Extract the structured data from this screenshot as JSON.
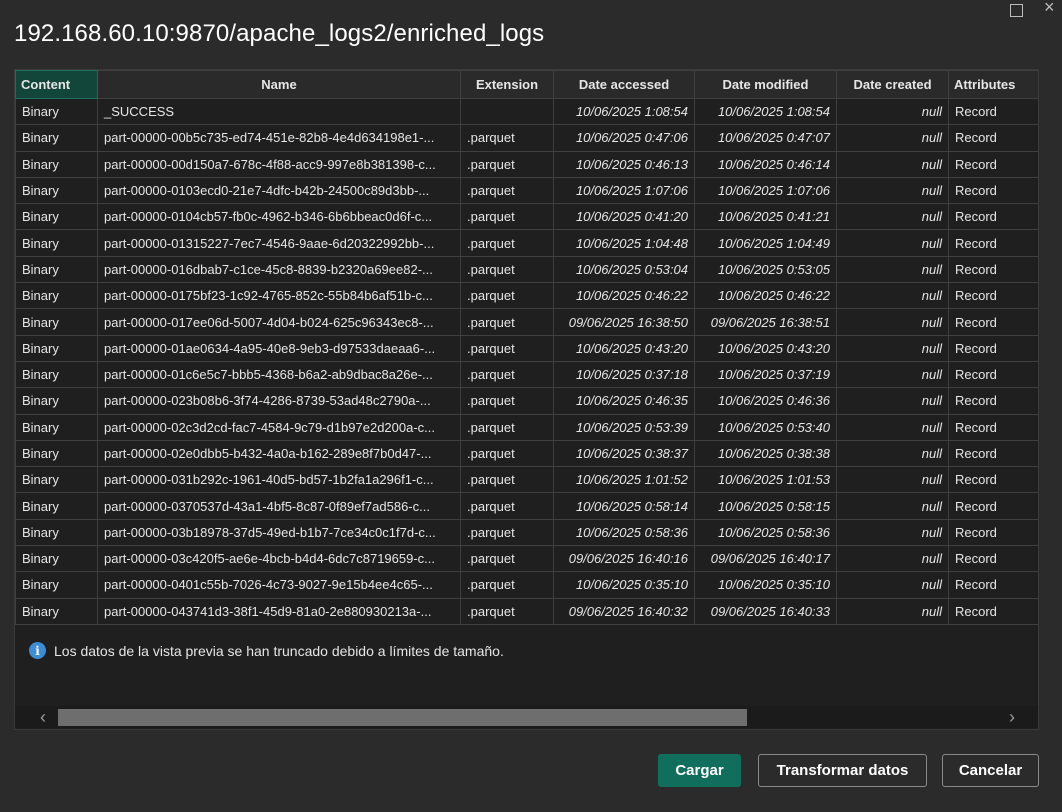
{
  "window": {
    "title": "192.168.60.10:9870/apache_logs2/enriched_logs"
  },
  "table": {
    "columns": [
      "Content",
      "Name",
      "Extension",
      "Date accessed",
      "Date modified",
      "Date created",
      "Attributes"
    ],
    "rows": [
      [
        "Binary",
        "_SUCCESS",
        "",
        "10/06/2025 1:08:54",
        "10/06/2025 1:08:54",
        "null",
        "Record"
      ],
      [
        "Binary",
        "part-00000-00b5c735-ed74-451e-82b8-4e4d634198e1-...",
        ".parquet",
        "10/06/2025 0:47:06",
        "10/06/2025 0:47:07",
        "null",
        "Record"
      ],
      [
        "Binary",
        "part-00000-00d150a7-678c-4f88-acc9-997e8b381398-c...",
        ".parquet",
        "10/06/2025 0:46:13",
        "10/06/2025 0:46:14",
        "null",
        "Record"
      ],
      [
        "Binary",
        "part-00000-0103ecd0-21e7-4dfc-b42b-24500c89d3bb-...",
        ".parquet",
        "10/06/2025 1:07:06",
        "10/06/2025 1:07:06",
        "null",
        "Record"
      ],
      [
        "Binary",
        "part-00000-0104cb57-fb0c-4962-b346-6b6bbeac0d6f-c...",
        ".parquet",
        "10/06/2025 0:41:20",
        "10/06/2025 0:41:21",
        "null",
        "Record"
      ],
      [
        "Binary",
        "part-00000-01315227-7ec7-4546-9aae-6d20322992bb-...",
        ".parquet",
        "10/06/2025 1:04:48",
        "10/06/2025 1:04:49",
        "null",
        "Record"
      ],
      [
        "Binary",
        "part-00000-016dbab7-c1ce-45c8-8839-b2320a69ee82-...",
        ".parquet",
        "10/06/2025 0:53:04",
        "10/06/2025 0:53:05",
        "null",
        "Record"
      ],
      [
        "Binary",
        "part-00000-0175bf23-1c92-4765-852c-55b84b6af51b-c...",
        ".parquet",
        "10/06/2025 0:46:22",
        "10/06/2025 0:46:22",
        "null",
        "Record"
      ],
      [
        "Binary",
        "part-00000-017ee06d-5007-4d04-b024-625c96343ec8-...",
        ".parquet",
        "09/06/2025 16:38:50",
        "09/06/2025 16:38:51",
        "null",
        "Record"
      ],
      [
        "Binary",
        "part-00000-01ae0634-4a95-40e8-9eb3-d97533daeaa6-...",
        ".parquet",
        "10/06/2025 0:43:20",
        "10/06/2025 0:43:20",
        "null",
        "Record"
      ],
      [
        "Binary",
        "part-00000-01c6e5c7-bbb5-4368-b6a2-ab9dbac8a26e-...",
        ".parquet",
        "10/06/2025 0:37:18",
        "10/06/2025 0:37:19",
        "null",
        "Record"
      ],
      [
        "Binary",
        "part-00000-023b08b6-3f74-4286-8739-53ad48c2790a-...",
        ".parquet",
        "10/06/2025 0:46:35",
        "10/06/2025 0:46:36",
        "null",
        "Record"
      ],
      [
        "Binary",
        "part-00000-02c3d2cd-fac7-4584-9c79-d1b97e2d200a-c...",
        ".parquet",
        "10/06/2025 0:53:39",
        "10/06/2025 0:53:40",
        "null",
        "Record"
      ],
      [
        "Binary",
        "part-00000-02e0dbb5-b432-4a0a-b162-289e8f7b0d47-...",
        ".parquet",
        "10/06/2025 0:38:37",
        "10/06/2025 0:38:38",
        "null",
        "Record"
      ],
      [
        "Binary",
        "part-00000-031b292c-1961-40d5-bd57-1b2fa1a296f1-c...",
        ".parquet",
        "10/06/2025 1:01:52",
        "10/06/2025 1:01:53",
        "null",
        "Record"
      ],
      [
        "Binary",
        "part-00000-0370537d-43a1-4bf5-8c87-0f89ef7ad586-c...",
        ".parquet",
        "10/06/2025 0:58:14",
        "10/06/2025 0:58:15",
        "null",
        "Record"
      ],
      [
        "Binary",
        "part-00000-03b18978-37d5-49ed-b1b7-7ce34c0c1f7d-c...",
        ".parquet",
        "10/06/2025 0:58:36",
        "10/06/2025 0:58:36",
        "null",
        "Record"
      ],
      [
        "Binary",
        "part-00000-03c420f5-ae6e-4bcb-b4d4-6dc7c8719659-c...",
        ".parquet",
        "09/06/2025 16:40:16",
        "09/06/2025 16:40:17",
        "null",
        "Record"
      ],
      [
        "Binary",
        "part-00000-0401c55b-7026-4c73-9027-9e15b4ee4c65-...",
        ".parquet",
        "10/06/2025 0:35:10",
        "10/06/2025 0:35:10",
        "null",
        "Record"
      ],
      [
        "Binary",
        "part-00000-043741d3-38f1-45d9-81a0-2e880930213a-...",
        ".parquet",
        "09/06/2025 16:40:32",
        "09/06/2025 16:40:33",
        "null",
        "Record"
      ]
    ]
  },
  "info": {
    "icon": "info-icon",
    "message": "Los datos de la vista previa se han truncado debido a límites de tamaño."
  },
  "buttons": {
    "load": "Cargar",
    "transform": "Transformar datos",
    "cancel": "Cancelar"
  },
  "icons": {
    "maximize": "maximize-icon",
    "close": "close-icon",
    "scroll_left": "chevron-left-icon",
    "scroll_right": "chevron-right-icon"
  },
  "colors": {
    "background": "#2b2b2b",
    "accent": "#126e5c",
    "selected_header": "#13463b",
    "info_icon": "#3d8cd6"
  }
}
